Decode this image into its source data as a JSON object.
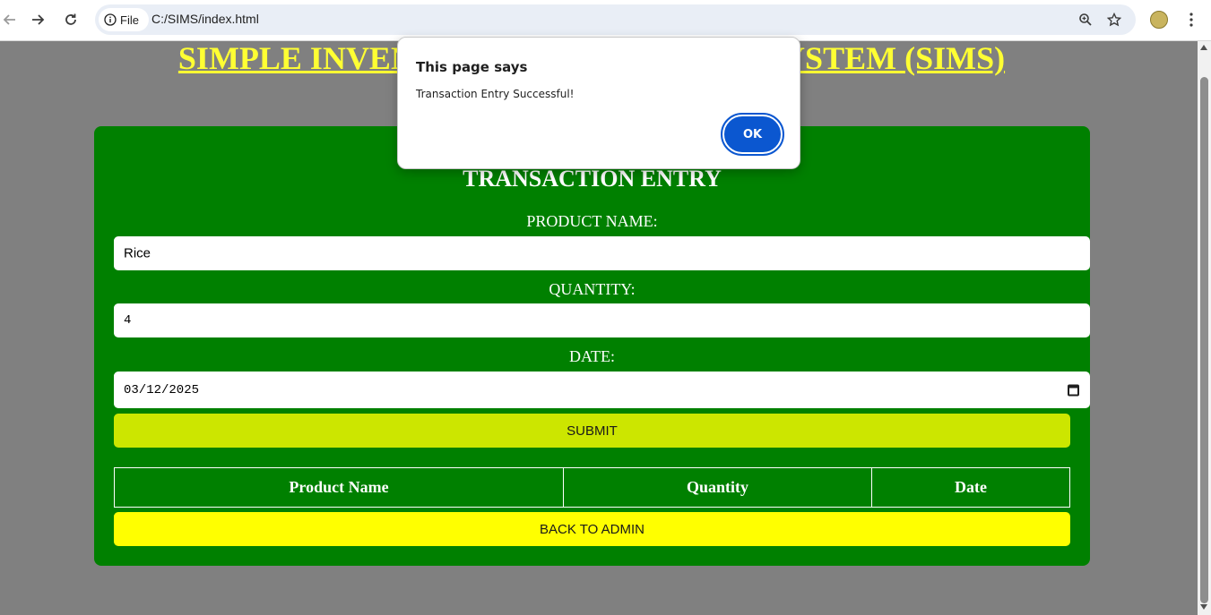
{
  "browser": {
    "site_chip_label": "File",
    "url": "C:/SIMS/index.html",
    "icons": [
      "back-icon",
      "forward-icon",
      "reload-icon",
      "info-icon",
      "zoom-icon",
      "bookmark-star-icon",
      "profile-avatar",
      "menu-icon"
    ]
  },
  "page": {
    "title": "SIMPLE INVENTORY MANAGEMENT SYSTEM (SIMS)",
    "panel": {
      "heading": "TRANSACTION ENTRY",
      "product_label": "PRODUCT NAME:",
      "product_value": "Rice",
      "quantity_label": "QUANTITY:",
      "quantity_value": "4",
      "date_label": "DATE:",
      "date_value": "03/12/2025",
      "submit_label": "SUBMIT",
      "table_headers": [
        "Product Name",
        "Quantity",
        "Date"
      ],
      "back_label": "BACK TO ADMIN"
    }
  },
  "dialog": {
    "title": "This page says",
    "message": "Transaction Entry Successful!",
    "ok_label": "OK"
  },
  "colors": {
    "page_bg": "#808080",
    "panel_bg": "#008000",
    "title_color": "#ffff33",
    "submit_bg": "#cce600",
    "back_bg": "#ffff00",
    "dialog_button": "#0b57d0"
  }
}
